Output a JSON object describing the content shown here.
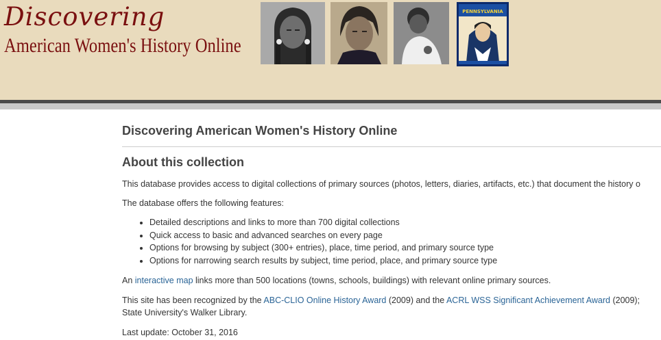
{
  "header": {
    "logo_line1": "Discovering",
    "logo_line2": "American Women's History Online",
    "photos": [
      {
        "name": "portrait-woman-braids-photo"
      },
      {
        "name": "portrait-woman-photo"
      },
      {
        "name": "portrait-baby-photo"
      },
      {
        "name": "pennsylvania-poster-image",
        "text": "PENNSYLVANIA"
      }
    ]
  },
  "main": {
    "title": "Discovering American Women's History Online",
    "about_heading": "About this collection",
    "intro": "This database provides access to digital collections of primary sources (photos, letters, diaries, artifacts, etc.) that document the history o",
    "features_intro": "The database offers the following features:",
    "features": [
      "Detailed descriptions and links to more than 700 digital collections",
      "Quick access to basic and advanced searches on every page",
      "Options for browsing by subject (300+ entries), place, time period, and primary source type",
      "Options for narrowing search results by subject, time period, place, and primary source type"
    ],
    "map_prefix": "An ",
    "map_link": "interactive map",
    "map_suffix": " links more than 500 locations (towns, schools, buildings) with relevant online primary sources.",
    "award_prefix": "This site has been recognized by the ",
    "award_link1": "ABC-CLIO Online History Award",
    "award_mid": " (2009) and the ",
    "award_link2": "ACRL WSS Significant Achievement Award",
    "award_suffix": " (2009);",
    "award_line2": "State University's Walker Library.",
    "last_update": "Last update: October 31, 2016"
  },
  "colors": {
    "banner": "#e9dbbd",
    "logo": "#7a1010",
    "link": "#2a6496"
  }
}
